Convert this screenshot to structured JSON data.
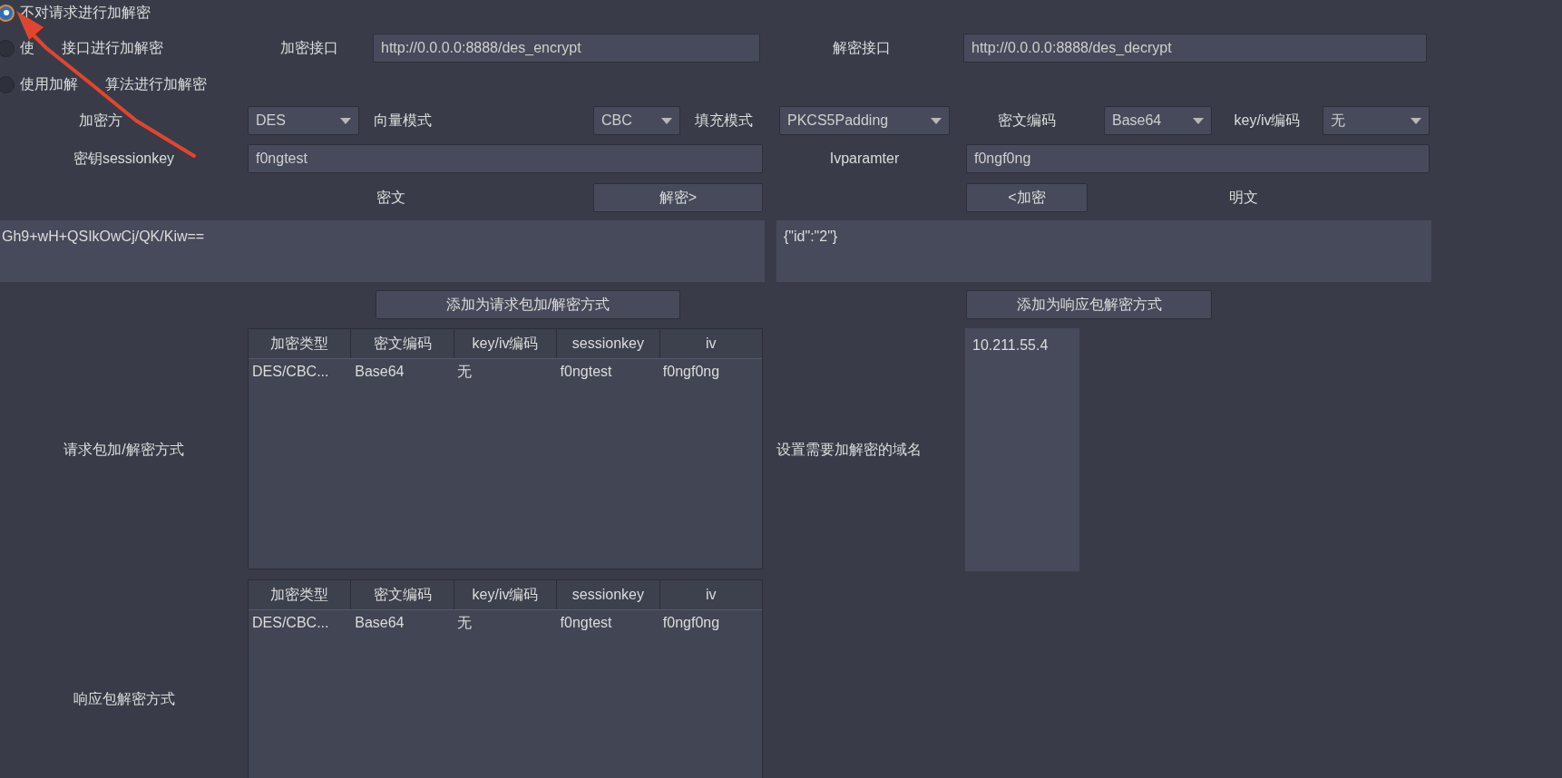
{
  "radio_options": [
    {
      "label_parts": [
        "不对请求进行加解密"
      ],
      "selected": true
    },
    {
      "label_parts": [
        "使",
        "接口进行加解密"
      ],
      "selected": false
    },
    {
      "label_parts": [
        "使用加解",
        "算法进行加解密"
      ],
      "selected": false
    }
  ],
  "endpoints": [
    {
      "label": "加密接口",
      "value": "http://0.0.0.0:8888/des_encrypt"
    },
    {
      "label": "解密接口",
      "value": "http://0.0.0.0:8888/des_decrypt"
    }
  ],
  "crypto_settings": [
    {
      "label": "加密方",
      "value": "DES"
    },
    {
      "label": "向量模式",
      "value": "CBC"
    },
    {
      "label": "填充模式",
      "value": "PKCS5Padding"
    },
    {
      "label": "密文编码",
      "value": "Base64"
    },
    {
      "label": "key/iv编码",
      "value": "无"
    }
  ],
  "key_fields": [
    {
      "label": "密钥sessionkey",
      "value": "f0ngtest"
    },
    {
      "label": "Ivparamter",
      "value": "f0ngf0ng"
    }
  ],
  "ciphertext_label": "密文",
  "decrypt_button": "解密>",
  "encrypt_button": "<加密",
  "plaintext_label": "明文",
  "ciphertext": "Gh9+wH+QSIkOwCj/QK/Kiw==",
  "plaintext": "{\"id\":\"2\"}",
  "add_request_button": "添加为请求包加/解密方式",
  "add_response_button": "添加为响应包解密方式",
  "request_table": {
    "label": "请求包加/解密方式",
    "columns": [
      "加密类型",
      "密文编码",
      "key/iv编码",
      "sessionkey",
      "iv"
    ],
    "rows": [
      [
        "DES/CBC...",
        "Base64",
        "无",
        "f0ngtest",
        "f0ngf0ng"
      ]
    ]
  },
  "domain_label": "设置需要加解密的域名",
  "domains": [
    "10.211.55.4"
  ],
  "response_table": {
    "label": "响应包解密方式",
    "columns": [
      "加密类型",
      "密文编码",
      "key/iv编码",
      "sessionkey",
      "iv"
    ],
    "rows": [
      [
        "DES/CBC...",
        "Base64",
        "无",
        "f0ngtest",
        "f0ngf0ng"
      ]
    ]
  }
}
